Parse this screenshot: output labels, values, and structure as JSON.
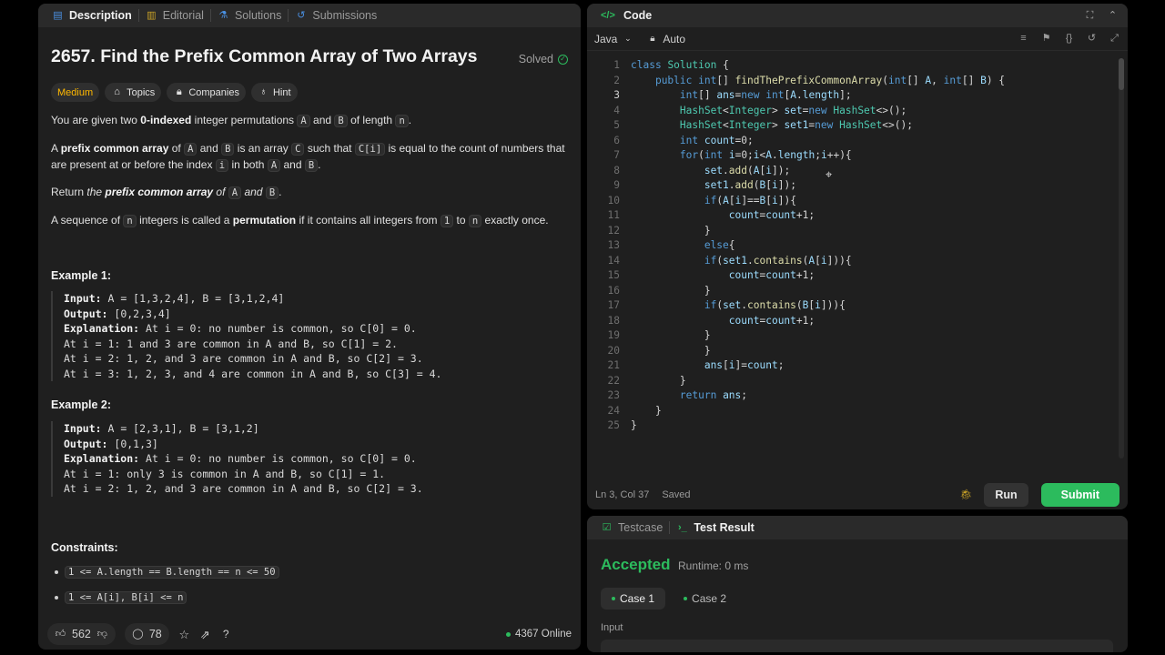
{
  "left": {
    "tabs": [
      {
        "label": "Description",
        "icon": "description-icon"
      },
      {
        "label": "Editorial",
        "icon": "book-icon"
      },
      {
        "label": "Solutions",
        "icon": "flask-icon"
      },
      {
        "label": "Submissions",
        "icon": "history-icon"
      }
    ],
    "title": "2657. Find the Prefix Common Array of Two Arrays",
    "status": "Solved",
    "chips": {
      "difficulty": "Medium",
      "topics": "Topics",
      "companies": "Companies",
      "hint": "Hint"
    },
    "p1": {
      "a": "You are given two ",
      "b": "0-indexed",
      "c": " integer permutations ",
      "A": "A",
      "and": " and ",
      "B": "B",
      "d": " of length ",
      "n": "n",
      "e": "."
    },
    "p2": {
      "a": "A ",
      "b": "prefix common array",
      "c": " of ",
      "A": "A",
      "and": " and ",
      "B": "B",
      "d": " is an array ",
      "C": "C",
      "e": " such that ",
      "Ci": "C[i]",
      "f": " is equal to the count of numbers that are present at or before the index ",
      "i": "i",
      "g": " in both ",
      "A2": "A",
      "and2": " and ",
      "B2": "B",
      "h": "."
    },
    "p3": {
      "a": "Return ",
      "b": "the ",
      "c": "prefix common array",
      "d": " of ",
      "A": "A",
      "e": " and ",
      "B": "B",
      "f": "."
    },
    "p4": {
      "a": "A sequence of ",
      "n": "n",
      "b": " integers is called a ",
      "c": "permutation",
      "d": " if it contains all integers from ",
      "one": "1",
      "e": " to ",
      "n2": "n",
      "f": " exactly once."
    },
    "example1": {
      "heading": "Example 1:",
      "input_label": "Input:",
      "input": " A = [1,3,2,4], B = [3,1,2,4]",
      "output_label": "Output:",
      "output": " [0,2,3,4]",
      "expl_label": "Explanation:",
      "expl": [
        " At i = 0: no number is common, so C[0] = 0.",
        "At i = 1: 1 and 3 are common in A and B, so C[1] = 2.",
        "At i = 2: 1, 2, and 3 are common in A and B, so C[2] = 3.",
        "At i = 3: 1, 2, 3, and 4 are common in A and B, so C[3] = 4."
      ]
    },
    "example2": {
      "heading": "Example 2:",
      "input_label": "Input:",
      "input": " A = [2,3,1], B = [3,1,2]",
      "output_label": "Output:",
      "output": " [0,1,3]",
      "expl_label": "Explanation:",
      "expl": [
        " At i = 0: no number is common, so C[0] = 0.",
        "At i = 1: only 3 is common in A and B, so C[1] = 1.",
        "At i = 2: 1, 2, and 3 are common in A and B, so C[2] = 3."
      ]
    },
    "constraints_heading": "Constraints:",
    "constraints": [
      "1 <= A.length == B.length == n <= 50",
      "1 <= A[i], B[i] <= n"
    ],
    "footer": {
      "likes": "562",
      "comments": "78",
      "online": "4367 Online"
    }
  },
  "code": {
    "title": "Code",
    "language": "Java",
    "mode": "Auto",
    "status": {
      "position": "Ln 3, Col 37",
      "saved": "Saved"
    },
    "run": "Run",
    "submit": "Submit",
    "lines": [
      "class Solution {",
      "    public int[] findThePrefixCommonArray(int[] A, int[] B) {",
      "        int[] ans=new int[A.length];",
      "        HashSet<Integer> set=new HashSet<>();",
      "        HashSet<Integer> set1=new HashSet<>();",
      "        int count=0;",
      "        for(int i=0;i<A.length;i++){",
      "            set.add(A[i]);",
      "            set1.add(B[i]);",
      "            if(A[i]==B[i]){",
      "                count=count+1;",
      "            }",
      "            else{",
      "            if(set1.contains(A[i])){",
      "                count=count+1;",
      "            }",
      "            if(set.contains(B[i])){",
      "                count=count+1;",
      "            }",
      "            }",
      "            ans[i]=count;",
      "        }",
      "        return ans;",
      "    }",
      "}"
    ]
  },
  "test": {
    "tabs": {
      "testcase": "Testcase",
      "result": "Test Result"
    },
    "verdict": "Accepted",
    "runtime": "Runtime: 0 ms",
    "cases": [
      "Case 1",
      "Case 2"
    ],
    "input_label": "Input"
  },
  "colors": {
    "accent_green": "#2cbb5d",
    "medium": "#ffb800"
  }
}
